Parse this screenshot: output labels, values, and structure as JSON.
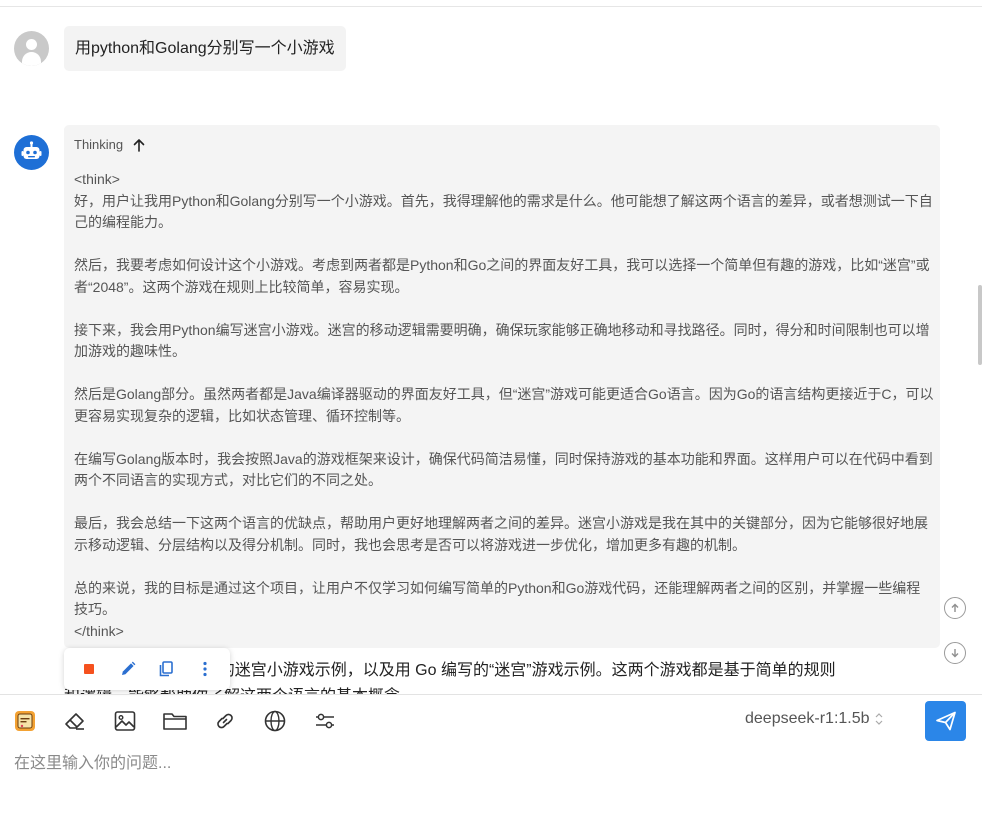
{
  "user_message": {
    "text": "用python和Golang分别写一个小游戏"
  },
  "assistant": {
    "thinking_label": "Thinking",
    "think_open": "<think>",
    "paragraphs": [
      "好，用户让我用Python和Golang分别写一个小游戏。首先，我得理解他的需求是什么。他可能想了解这两个语言的差异，或者想测试一下自己的编程能力。",
      "然后，我要考虑如何设计这个小游戏。考虑到两者都是Python和Go之间的界面友好工具，我可以选择一个简单但有趣的游戏，比如“迷宫”或者“2048”。这两个游戏在规则上比较简单，容易实现。",
      "接下来，我会用Python编写迷宫小游戏。迷宫的移动逻辑需要明确，确保玩家能够正确地移动和寻找路径。同时，得分和时间限制也可以增加游戏的趣味性。",
      "然后是Golang部分。虽然两者都是Java编译器驱动的界面友好工具，但“迷宫”游戏可能更适合Go语言。因为Go的语言结构更接近于C，可以更容易实现复杂的逻辑，比如状态管理、循环控制等。",
      "在编写Golang版本时，我会按照Java的游戏框架来设计，确保代码简洁易懂，同时保持游戏的基本功能和界面。这样用户可以在代码中看到两个不同语言的实现方式，对比它们的不同之处。",
      "最后，我会总结一下这两个语言的优缺点，帮助用户更好地理解两者之间的差异。迷宫小游戏是我在其中的关键部分，因为它能够很好地展示移动逻辑、分层结构以及得分机制。同时，我也会思考是否可以将游戏进一步优化，增加更多有趣的机制。",
      "总的来说，我的目标是通过这个项目，让用户不仅学习如何编写简单的Python和Go游戏代码，还能理解两者之间的区别，并掌握一些编程技巧。"
    ],
    "think_close": "</think>",
    "answer_line1": "以下是用 Python 编写的迷宫小游戏示例，以及用 Go 编写的“迷宫”游戏示例。这两个游戏都是基于简单的规则",
    "answer_line2": "和逻辑，能够帮助你了解这两个语言的基本概念。"
  },
  "action_bar": {
    "stop_icon": "stop-square-icon",
    "edit_icon": "pencil-icon",
    "copy_icon": "copy-icon",
    "more_icon": "more-vertical-icon",
    "stop_color": "#f5511e",
    "accent": "#2b6fd0"
  },
  "composer": {
    "model_name": "deepseek-r1:1.5b",
    "placeholder": "在这里输入你的问题...",
    "tools": [
      "app-logo-icon",
      "eraser-icon",
      "image-icon",
      "folder-icon",
      "link-icon",
      "globe-icon",
      "settings-sliders-icon"
    ],
    "send_color": "#2b86e8"
  }
}
